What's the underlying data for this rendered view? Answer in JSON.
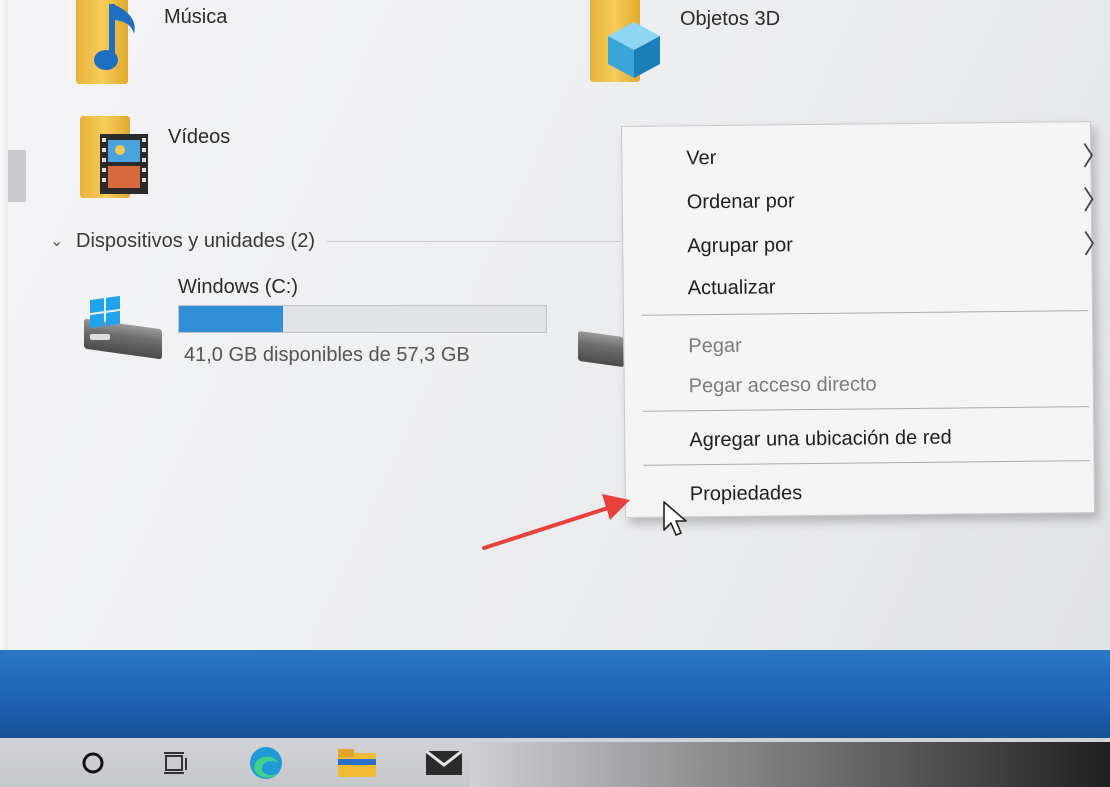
{
  "explorer": {
    "folders": [
      {
        "name": "Música",
        "icon": "music-folder-icon"
      },
      {
        "name": "Objetos 3D",
        "icon": "3d-objects-folder-icon"
      },
      {
        "name": "Vídeos",
        "icon": "videos-folder-icon"
      }
    ],
    "devices_group": {
      "chevron": "⌄",
      "title": "Dispositivos y unidades (2)"
    },
    "drive": {
      "name": "Windows (C:)",
      "free_text": "41,0 GB disponibles de 57,3 GB",
      "used_fraction": 0.284,
      "icon": "windows-drive-icon"
    }
  },
  "context_menu": {
    "items": [
      {
        "label": "Ver",
        "submenu": true,
        "disabled": false
      },
      {
        "label": "Ordenar por",
        "submenu": true,
        "disabled": false
      },
      {
        "label": "Agrupar por",
        "submenu": true,
        "disabled": false
      },
      {
        "label": "Actualizar",
        "submenu": false,
        "disabled": false
      },
      {
        "label": "Pegar",
        "submenu": false,
        "disabled": true
      },
      {
        "label": "Pegar acceso directo",
        "submenu": false,
        "disabled": true
      },
      {
        "label": "Agregar una ubicación de red",
        "submenu": false,
        "disabled": false
      },
      {
        "label": "Propiedades",
        "submenu": false,
        "disabled": false
      }
    ],
    "submenu_arrow": "〉"
  },
  "taskbar": {
    "icons": [
      "search-circle-icon",
      "task-view-icon",
      "edge-icon",
      "file-explorer-icon",
      "mail-icon"
    ]
  },
  "colors": {
    "accent": "#2f8ed6",
    "annotation_arrow": "#e8413c"
  }
}
